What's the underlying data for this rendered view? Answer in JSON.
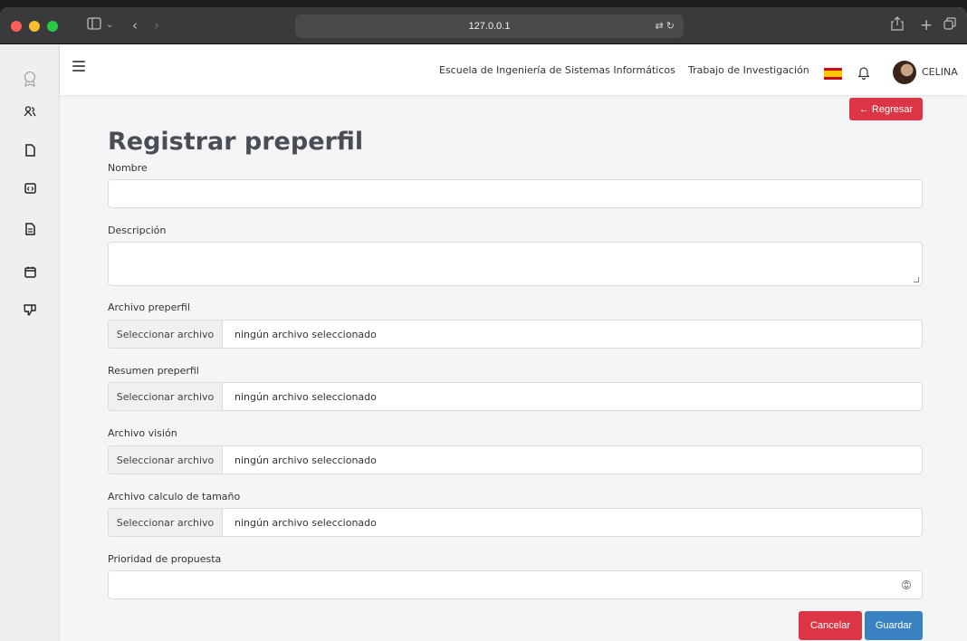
{
  "browser": {
    "url": "127.0.0.1"
  },
  "nav": {
    "school": "Escuela de Ingeniería de Sistemas Informáticos",
    "research": "Trabajo de Investigación",
    "user": "CELINA"
  },
  "page": {
    "title": "Registrar preperfil",
    "back_button": "← Regresar",
    "cancel_button": "Cancelar",
    "save_button": "Guardar"
  },
  "form": {
    "name_label": "Nombre",
    "name_value": "",
    "description_label": "Descripción",
    "description_value": "",
    "file_fields": [
      {
        "label": "Archivo preperfil",
        "button": "Seleccionar archivo",
        "status": "ningún archivo seleccionado"
      },
      {
        "label": "Resumen preperfil",
        "button": "Seleccionar archivo",
        "status": "ningún archivo seleccionado"
      },
      {
        "label": "Archivo visión",
        "button": "Seleccionar archivo",
        "status": "ningún archivo seleccionado"
      },
      {
        "label": "Archivo calculo de tamaño",
        "button": "Seleccionar archivo",
        "status": "ningún archivo seleccionado"
      }
    ],
    "priority_label": "Prioridad de propuesta",
    "priority_value": ""
  },
  "colors": {
    "danger": "#dc3545",
    "primary": "#3a81c4",
    "title": "#4a4d55"
  }
}
